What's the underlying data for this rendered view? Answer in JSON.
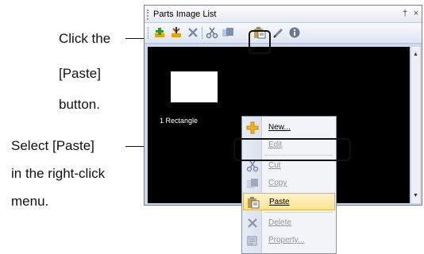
{
  "annotations": {
    "paste_button_callout": [
      "Click the",
      "[Paste]",
      "button."
    ],
    "context_menu_callout": [
      "Select [Paste]",
      "in the right-click",
      "menu."
    ]
  },
  "panel": {
    "title": "Parts Image List",
    "pin_icon": "pin-icon",
    "close_icon": "close-icon",
    "pin_glyph": "†",
    "close_glyph": "×"
  },
  "toolbar": {
    "tools": [
      "new-icon",
      "edit-icon",
      "delete-icon",
      "cut-icon",
      "copy-icon",
      "paste-icon",
      "pen-icon",
      "info-icon"
    ]
  },
  "parts": [
    {
      "label": "1 Rectangle"
    }
  ],
  "context_menu": {
    "items": [
      {
        "label": "New...",
        "icon": "new-icon",
        "enabled": true
      },
      {
        "label": "Edit",
        "icon": "",
        "enabled": false
      },
      {
        "label": "Cut",
        "icon": "cut-icon",
        "enabled": false
      },
      {
        "label": "Copy",
        "icon": "copy-icon",
        "enabled": false
      },
      {
        "label": "Paste",
        "icon": "paste-icon",
        "enabled": true,
        "selected": true
      },
      {
        "label": "Delete",
        "icon": "delete-icon",
        "enabled": false
      },
      {
        "label": "Property...",
        "icon": "property-icon",
        "enabled": false
      }
    ]
  },
  "colors": {
    "canvas": "#000000",
    "menu_highlight": "#ffe38c",
    "panel_border": "#6d7fa3"
  }
}
